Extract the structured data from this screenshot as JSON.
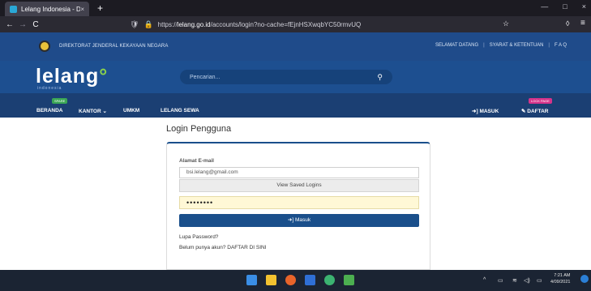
{
  "browser": {
    "tab_title": "Lelang Indonesia - DJKN",
    "tab_close": "×",
    "new_tab": "+",
    "back": "←",
    "forward": "→",
    "reload": "C",
    "url_prefix": "https://",
    "url_host": "lelang.go.id",
    "url_path": "/accounts/login?no-cache=fEjnHSXwqbYC50rmvUQ",
    "minimize": "—",
    "maximize": "□",
    "close": "×"
  },
  "site": {
    "org_name": "DIREKTORAT JENDERAL KEKAYAAN NEGARA",
    "top_links": [
      "SELAMAT DATANG",
      "SYARAT & KETENTUAN",
      "F A Q"
    ],
    "logo_text": "lelang",
    "logo_sub": "indonesia",
    "search_placeholder": "Pencarian...",
    "nav": [
      "BERANDA",
      "KANTOR",
      "UMKM",
      "LELANG SEWA"
    ],
    "nav_badge_new": "SPARE",
    "masuk_nav": "MASUK",
    "daftar_nav": "DAFTAR",
    "daftar_badge": "LOCK PAGE"
  },
  "login": {
    "title": "Login Pengguna",
    "email_label": "Alamat E-mail",
    "email_value": "bsi.lelang@gmail.com",
    "view_saved": "View Saved Logins",
    "password_value": "••••••••",
    "submit": "Masuk",
    "forgot": "Lupa Password?",
    "signup_prefix": "Belum punya akun?",
    "signup_link": "DAFTAR DI SINI"
  },
  "taskbar": {
    "time": "7:21 AM",
    "date": "4/09/2021"
  },
  "colors": {
    "header_dark": "#1b3f73",
    "header": "#1d4f90",
    "button": "#1a4f8b",
    "password_bg": "#fff8d6"
  }
}
